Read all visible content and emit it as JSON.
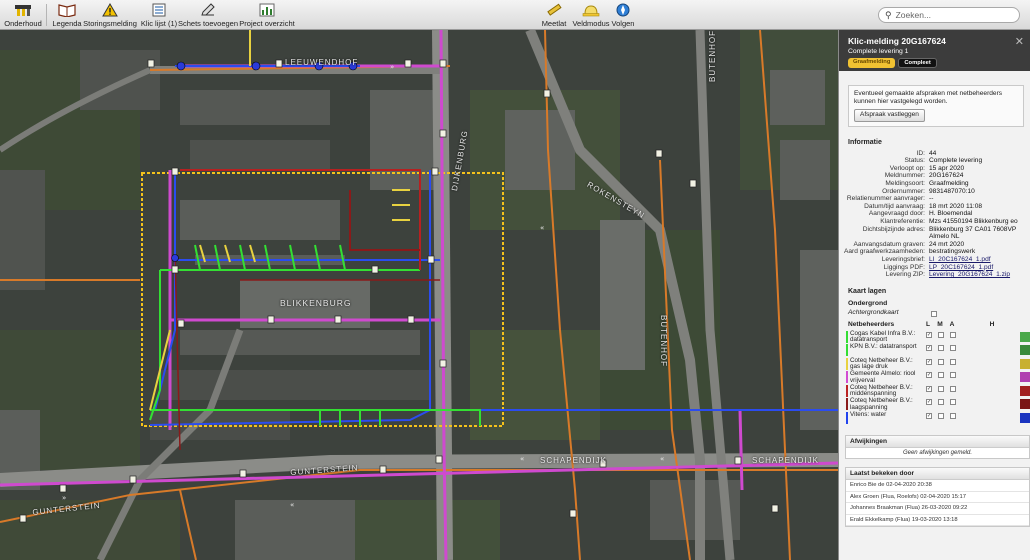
{
  "toolbar": {
    "items": [
      {
        "label": "Onderhoud",
        "icon": "tools-icon"
      },
      {
        "label": "Legenda",
        "icon": "book-icon"
      },
      {
        "label": "Storingsmelding",
        "icon": "warning-icon"
      },
      {
        "label": "Klic lijst (1)",
        "icon": "list-icon"
      },
      {
        "label": "Schets toevoegen",
        "icon": "pencil-icon"
      },
      {
        "label": "Project overzicht",
        "icon": "chart-icon"
      },
      {
        "label": "Meetlat",
        "icon": "ruler-icon"
      },
      {
        "label": "Veldmodus",
        "icon": "hat-icon"
      },
      {
        "label": "Volgen",
        "icon": "compass-icon"
      }
    ],
    "search_placeholder": "Zoeken..."
  },
  "map": {
    "labels": [
      "BLIKKENBURG",
      "BUTENHOF",
      "BUTENHOF",
      "ROKENSTEYN",
      "SCHAPENDIJK",
      "SCHAPENDIJK",
      "GUNTERSTEIN",
      "GUNTERSTEIN",
      "LEEUWENDHOF",
      "DIJKENBURG"
    ]
  },
  "panel": {
    "title": "Klic-melding 20G167624",
    "subtitle": "Complete levering 1",
    "badge_1": "Graafmelding",
    "badge_2": "Compleet",
    "close": "✕",
    "note_text": "Eventueel gemaakte afspraken met netbeheerders kunnen hier vastgelegd worden.",
    "note_button": "Afspraak vastleggen",
    "info_title": "Informatie",
    "info": [
      {
        "k": "ID:",
        "v": "44"
      },
      {
        "k": "Status:",
        "v": "Complete levering"
      },
      {
        "k": "Verloopt op:",
        "v": "15 apr 2020"
      },
      {
        "k": "Meldnummer:",
        "v": "20G167624"
      },
      {
        "k": "Meldingsoort:",
        "v": "Graafmelding"
      },
      {
        "k": "Ordernummer:",
        "v": "9831487070:10"
      },
      {
        "k": "Relatienummer aanvrager:",
        "v": "--"
      },
      {
        "k": "Datum/tijd aanvraag:",
        "v": "18 mrt 2020 11:08"
      },
      {
        "k": "Aangevraagd door:",
        "v": "H. Bloemendal"
      },
      {
        "k": "Klantreferentie:",
        "v": "Mzs 41550194 Blikkenburg eo"
      },
      {
        "k": "Dichtsbijzijnde adres:",
        "v": "Blikkenburg 37 CA01 7608VP Almelo NL"
      },
      {
        "k": "Aanvangsdatum graven:",
        "v": "24 mrt 2020"
      },
      {
        "k": "Aard graafwerkzaamheden:",
        "v": "bestratingswerk"
      },
      {
        "k": "Leveringsbrief:",
        "v": "LI_20C167624_1.pdf",
        "link": true
      },
      {
        "k": "Liggings PDF:",
        "v": "LP_20C167624_1.pdf",
        "link": true
      },
      {
        "k": "Levering ZIP:",
        "v": "Levering_20G167624_1.zip",
        "link": true
      }
    ],
    "layers_title": "Kaart lagen",
    "ondergrond": "Ondergrond",
    "achtergrond": "Achtergrondkaart",
    "net_header": {
      "name": "Netbeheerders",
      "l": "L",
      "m": "M",
      "a": "A",
      "h": "H"
    },
    "networks": [
      {
        "name": "Cogas Kabel Infra B.V.: datatransport",
        "color": "#33dd33",
        "box": "#4aa84a"
      },
      {
        "name": "KPN B.V.: datatransport",
        "color": "#33dd33",
        "box": "#3a8a3a"
      },
      {
        "name": "Coteq Netbeheer B.V.: gas lage druk",
        "color": "#e8d240",
        "box": "#c8b030"
      },
      {
        "name": "Gemeente Almelo: riool vrijverval",
        "color": "#d24bd2",
        "box": "#b03fb0"
      },
      {
        "name": "Coteq Netbeheer B.V.: middenspanning",
        "color": "#bb2222",
        "box": "#a22020"
      },
      {
        "name": "Coteq Netbeheer B.V.: laagspanning",
        "color": "#8a1a1a",
        "box": "#7a1515"
      },
      {
        "name": "Vitens: water",
        "color": "#2244ee",
        "box": "#1a34c0"
      }
    ],
    "afwijkingen_title": "Afwijkingen",
    "afwijkingen_text": "Geen afwijkingen gemeld.",
    "laatst_title": "Laatst bekeken door",
    "laatst": [
      "Enrico Bie de 02-04-2020 20:38",
      "Alex Groen (Flua, Roelofs) 02-04-2020 15:17",
      "Johannes Braakman (Flua) 26-03-2020 09:22",
      "Erald Ekkelkamp (Flua) 19-03-2020 13:18"
    ]
  }
}
